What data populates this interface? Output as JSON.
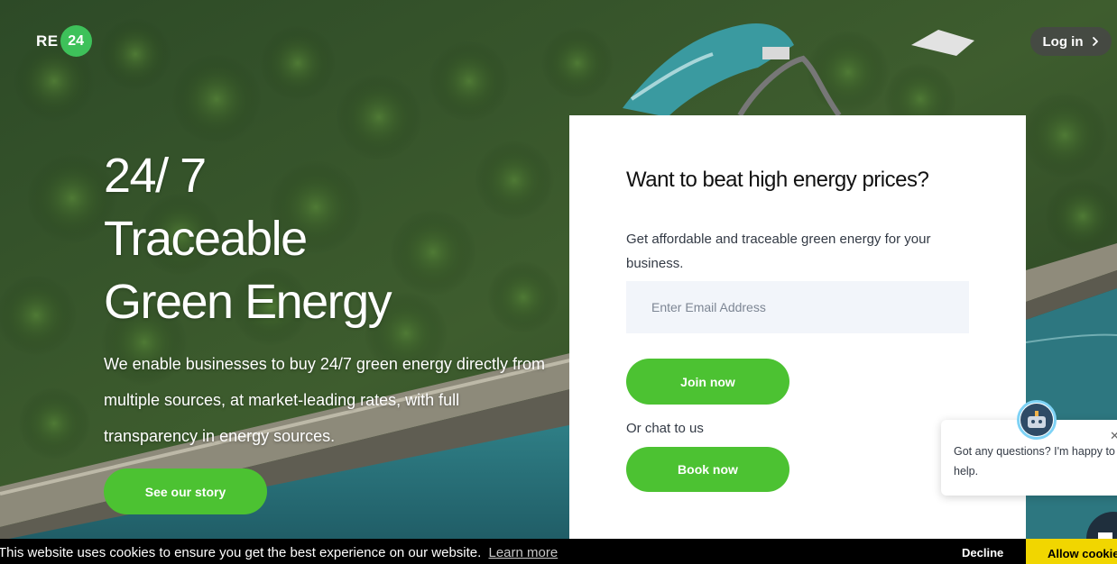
{
  "header": {
    "logo_text": "RE",
    "logo_badge": "24",
    "login_label": "Log in"
  },
  "hero": {
    "title_line1": "24/ 7",
    "title_line2": "Traceable",
    "title_line3": "Green Energy",
    "description": "We enable businesses to buy 24/7 green energy directly from multiple sources, at market-leading rates, with full transparency in energy sources.",
    "cta_label": "See our story"
  },
  "signup": {
    "title": "Want to beat high energy prices?",
    "subtitle": "Get affordable and traceable green energy for your business.",
    "email_placeholder": "Enter Email Address",
    "email_value": "",
    "join_label": "Join now",
    "chat_label": "Or chat to us",
    "book_label": "Book now"
  },
  "chat_widget": {
    "message": "Got any questions? I'm happy to help.",
    "close_glyph": "✕"
  },
  "cookie_bar": {
    "message": "This website uses cookies to ensure you get the best experience on our website.",
    "learn_more_label": "Learn more",
    "decline_label": "Decline",
    "allow_label": "Allow cookies"
  },
  "colors": {
    "accent_green": "#4cc232",
    "logo_green": "#3ec15a",
    "cookie_allow": "#f1d600"
  },
  "icons": [
    "chevron-right-icon",
    "close-icon",
    "chat-bot-icon",
    "chat-icon"
  ]
}
